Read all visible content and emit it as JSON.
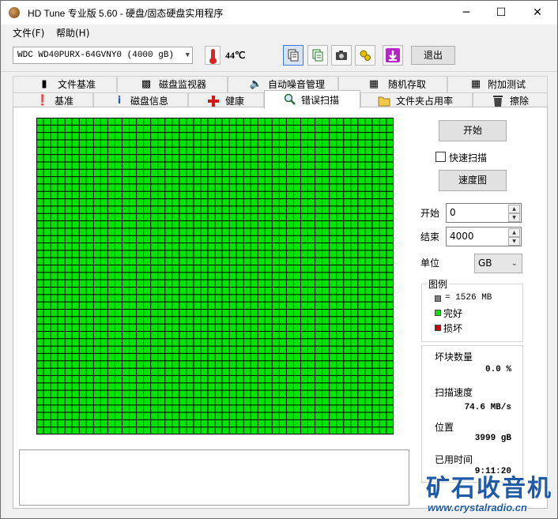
{
  "window": {
    "title": "HD Tune 专业版 5.60 - 硬盘/固态硬盘实用程序"
  },
  "titlebar_buttons": {
    "minimize": "─",
    "maximize": "☐",
    "close": "✕"
  },
  "menu": [
    {
      "label": "文件(F)"
    },
    {
      "label": "帮助(H)"
    }
  ],
  "toolbar": {
    "drive": "WDC WD40PURX-64GVNY0 (4000 gB)",
    "temperature": "44℃",
    "exit_label": "退出",
    "icons": [
      "copy-info-icon",
      "copy-text-icon",
      "screenshot-icon",
      "options-icon",
      "save-icon"
    ]
  },
  "tabs_row1": [
    {
      "label": "文件基准",
      "icon": "file-benchmark-icon"
    },
    {
      "label": "磁盘监视器",
      "icon": "disk-monitor-icon"
    },
    {
      "label": "自动噪音管理",
      "icon": "speaker-icon"
    },
    {
      "label": "随机存取",
      "icon": "random-access-icon"
    },
    {
      "label": "附加测试",
      "icon": "extra-tests-icon"
    }
  ],
  "tabs_row2": [
    {
      "label": "基准",
      "icon": "benchmark-icon"
    },
    {
      "label": "磁盘信息",
      "icon": "info-icon"
    },
    {
      "label": "健康",
      "icon": "health-cross-icon"
    },
    {
      "label": "错误扫描",
      "icon": "magnifier-icon",
      "active": true
    },
    {
      "label": "文件夹占用率",
      "icon": "folder-icon"
    },
    {
      "label": "擦除",
      "icon": "trash-icon"
    }
  ],
  "scan": {
    "start_button": "开始",
    "quick_scan_label": "快速扫描",
    "quick_scan_checked": false,
    "speed_map_button": "速度图",
    "start_label": "开始",
    "start_value": "0",
    "end_label": "结束",
    "end_value": "4000",
    "unit_label": "单位",
    "unit_value": "GB",
    "grid_columns": 50,
    "grid_rows": 43,
    "block_color_ok": "#00e600",
    "block_color_bad": "#cc0000",
    "block_color_unit": "#808080",
    "grid_line_color": "#000000"
  },
  "legend": {
    "title": "图例",
    "block_size": "= 1526 MB",
    "ok": "完好",
    "bad": "损坏"
  },
  "stats": {
    "bad_blocks_label": "坏块数量",
    "bad_blocks_value": "0.0 %",
    "scan_speed_label": "扫描速度",
    "scan_speed_value": "74.6 MB/s",
    "position_label": "位置",
    "position_value": "3999 gB",
    "elapsed_label": "已用时间",
    "elapsed_value": "9:11:20"
  },
  "watermark": {
    "text": "矿石收音机",
    "url": "www.crystalradio.cn"
  }
}
